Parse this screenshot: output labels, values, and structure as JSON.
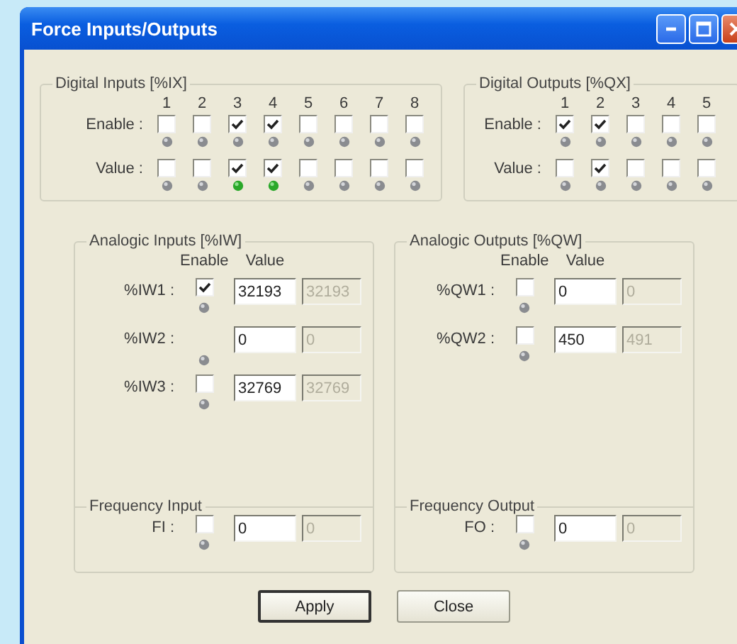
{
  "window": {
    "title": "Force Inputs/Outputs"
  },
  "digital_inputs": {
    "title": "Digital Inputs [%IX]",
    "enable_label": "Enable :",
    "value_label": "Value :",
    "channels": [
      {
        "number": "1",
        "enable": false,
        "enable_led": false,
        "value": false,
        "value_led": false
      },
      {
        "number": "2",
        "enable": false,
        "enable_led": false,
        "value": false,
        "value_led": false
      },
      {
        "number": "3",
        "enable": true,
        "enable_led": false,
        "value": true,
        "value_led": true
      },
      {
        "number": "4",
        "enable": true,
        "enable_led": false,
        "value": true,
        "value_led": true
      },
      {
        "number": "5",
        "enable": false,
        "enable_led": false,
        "value": false,
        "value_led": false
      },
      {
        "number": "6",
        "enable": false,
        "enable_led": false,
        "value": false,
        "value_led": false
      },
      {
        "number": "7",
        "enable": false,
        "enable_led": false,
        "value": false,
        "value_led": false
      },
      {
        "number": "8",
        "enable": false,
        "enable_led": false,
        "value": false,
        "value_led": false
      }
    ]
  },
  "digital_outputs": {
    "title": "Digital Outputs [%QX]",
    "enable_label": "Enable :",
    "value_label": "Value :",
    "channels": [
      {
        "number": "1",
        "enable": true,
        "enable_led": false,
        "value": false,
        "value_led": false
      },
      {
        "number": "2",
        "enable": true,
        "enable_led": false,
        "value": true,
        "value_led": false
      },
      {
        "number": "3",
        "enable": false,
        "enable_led": false,
        "value": false,
        "value_led": false
      },
      {
        "number": "4",
        "enable": false,
        "enable_led": false,
        "value": false,
        "value_led": false
      },
      {
        "number": "5",
        "enable": false,
        "enable_led": false,
        "value": false,
        "value_led": false
      }
    ]
  },
  "analog_inputs": {
    "title": "Analogic Inputs [%IW]",
    "enable_header": "Enable",
    "value_header": "Value",
    "rows": [
      {
        "label": "%IW1 :",
        "kind": "checkbox",
        "enabled": true,
        "led": false,
        "value": "32193",
        "reading": "32193"
      },
      {
        "label": "%IW2 :",
        "kind": "led_only",
        "led": false,
        "value": "0",
        "reading": "0"
      },
      {
        "label": "%IW3 :",
        "kind": "checkbox",
        "enabled": false,
        "led": false,
        "value": "32769",
        "reading": "32769"
      }
    ],
    "frequency": {
      "title": "Frequency Input",
      "rows": [
        {
          "label": "FI :",
          "kind": "checkbox",
          "enabled": false,
          "led": false,
          "value": "0",
          "reading": "0"
        }
      ]
    }
  },
  "analog_outputs": {
    "title": "Analogic Outputs [%QW]",
    "enable_header": "Enable",
    "value_header": "Value",
    "rows": [
      {
        "label": "%QW1 :",
        "kind": "checkbox",
        "enabled": false,
        "led": false,
        "value": "0",
        "reading": "0"
      },
      {
        "label": "%QW2 :",
        "kind": "checkbox",
        "enabled": false,
        "led": false,
        "value": "450",
        "reading": "491"
      }
    ],
    "frequency": {
      "title": "Frequency Output",
      "rows": [
        {
          "label": "FO :",
          "kind": "checkbox",
          "enabled": false,
          "led": false,
          "value": "0",
          "reading": "0"
        }
      ]
    }
  },
  "buttons": [
    {
      "label": "Apply",
      "default": true
    },
    {
      "label": "Close",
      "default": false
    }
  ]
}
